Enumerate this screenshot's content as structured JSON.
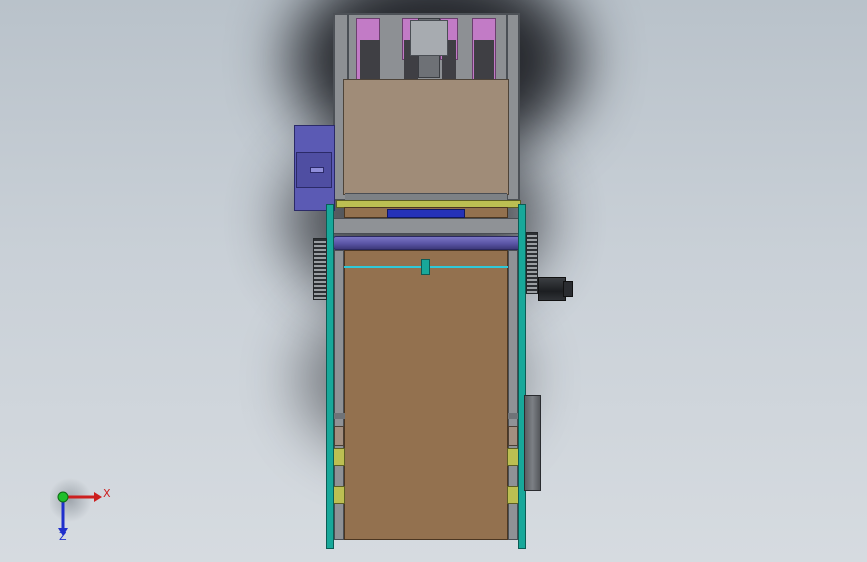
{
  "viewport": {
    "background": "#c8cfd6"
  },
  "triad": {
    "x_label": "X",
    "z_label": "Z",
    "x_color": "#cc1f1f",
    "y_color": "#1fbf2a",
    "z_color": "#1f2fcc"
  },
  "colors": {
    "cyan_frame": "#18a89a",
    "brown_belt": "#93714f",
    "tan_panel": "#a08c78",
    "magenta": "#c27bc6",
    "dark_block": "#3f3f44",
    "purple_motor": "#5b5ab4",
    "blue_bar": "#2532b8",
    "roller": "#5a55a5",
    "yellow_band": "#bcbf52",
    "steel": "#8f9296"
  }
}
